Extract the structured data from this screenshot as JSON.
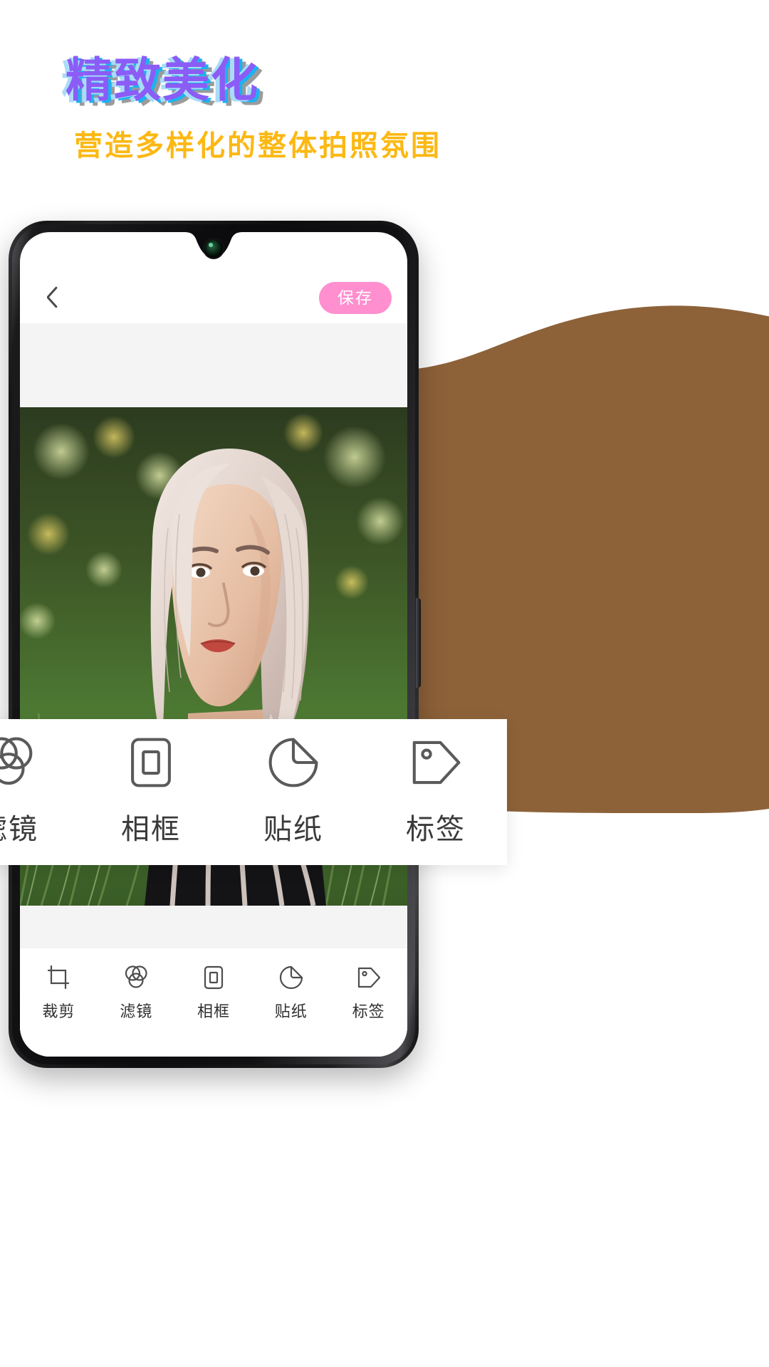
{
  "promo": {
    "headline": "精致美化",
    "subtitle": "营造多样化的整体拍照氛围",
    "headline_colors": {
      "main": "#8b5cf6",
      "cyan": "#19b4f0",
      "light_blue": "#a9dcf7",
      "gray": "#9b9b9b"
    },
    "subtitle_color": "#fcb813",
    "accent_color": "#ff8fcf",
    "blob_color": "#8d6239"
  },
  "app": {
    "appbar": {
      "back_icon": "chevron-left-icon",
      "save_label": "保存"
    },
    "nav": {
      "items": [
        {
          "label": "裁剪",
          "icon": "crop-icon"
        },
        {
          "label": "滤镜",
          "icon": "filter-circles-icon"
        },
        {
          "label": "相框",
          "icon": "frame-icon"
        },
        {
          "label": "贴纸",
          "icon": "sticker-peel-icon"
        },
        {
          "label": "标签",
          "icon": "tag-icon"
        }
      ]
    },
    "popup": {
      "items": [
        {
          "label": "滤镜",
          "icon": "filter-circles-icon"
        },
        {
          "label": "相框",
          "icon": "frame-icon"
        },
        {
          "label": "贴纸",
          "icon": "sticker-peel-icon"
        },
        {
          "label": "标签",
          "icon": "tag-icon"
        }
      ]
    }
  }
}
